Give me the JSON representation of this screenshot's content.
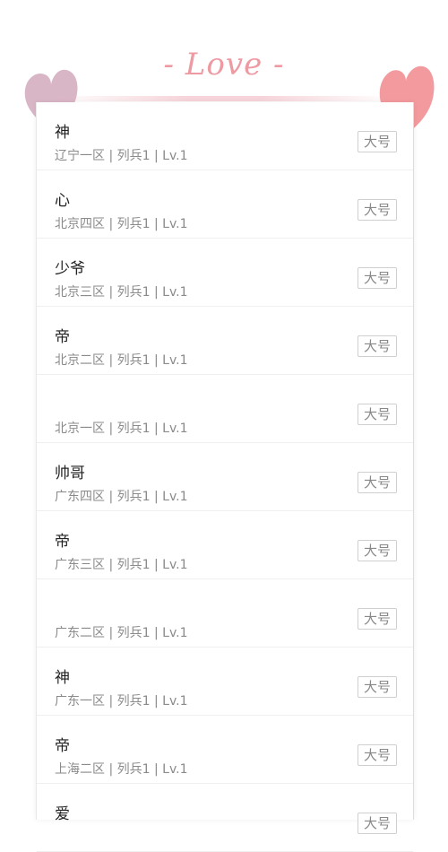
{
  "header": {
    "title": "- Love -",
    "colors": {
      "heart_left": "#d9b6c6",
      "heart_right": "#f29a9e",
      "title": "#ee9aa2"
    }
  },
  "rows": [
    {
      "name": "神",
      "server": "辽宁一区",
      "cls": "列兵1",
      "level": "Lv.1",
      "meta": "辽宁一区 | 列兵1 | Lv.1",
      "action": "大号"
    },
    {
      "name": "心",
      "server": "北京四区",
      "cls": "列兵1",
      "level": "Lv.1",
      "meta": "北京四区 | 列兵1 | Lv.1",
      "action": "大号"
    },
    {
      "name": "少爷",
      "server": "北京三区",
      "cls": "列兵1",
      "level": "Lv.1",
      "meta": "北京三区 | 列兵1 | Lv.1",
      "action": "大号"
    },
    {
      "name": "帝",
      "server": "北京二区",
      "cls": "列兵1",
      "level": "Lv.1",
      "meta": "北京二区 | 列兵1 | Lv.1",
      "action": "大号"
    },
    {
      "name": "",
      "server": "北京一区",
      "cls": "列兵1",
      "level": "Lv.1",
      "meta": "北京一区 | 列兵1 | Lv.1",
      "action": "大号"
    },
    {
      "name": "帅哥",
      "server": "广东四区",
      "cls": "列兵1",
      "level": "Lv.1",
      "meta": "广东四区 | 列兵1 | Lv.1",
      "action": "大号"
    },
    {
      "name": "帝",
      "server": "广东三区",
      "cls": "列兵1",
      "level": "Lv.1",
      "meta": "广东三区 | 列兵1 | Lv.1",
      "action": "大号"
    },
    {
      "name": "",
      "server": "广东二区",
      "cls": "列兵1",
      "level": "Lv.1",
      "meta": "广东二区 | 列兵1 | Lv.1",
      "action": "大号"
    },
    {
      "name": "神",
      "server": "广东一区",
      "cls": "列兵1",
      "level": "Lv.1",
      "meta": "广东一区 | 列兵1 | Lv.1",
      "action": "大号"
    },
    {
      "name": "帝",
      "server": "上海二区",
      "cls": "列兵1",
      "level": "Lv.1",
      "meta": "上海二区 | 列兵1 | Lv.1",
      "action": "大号"
    },
    {
      "name": "爱",
      "server": "",
      "cls": "",
      "level": "",
      "meta": "",
      "action": "大号"
    }
  ]
}
